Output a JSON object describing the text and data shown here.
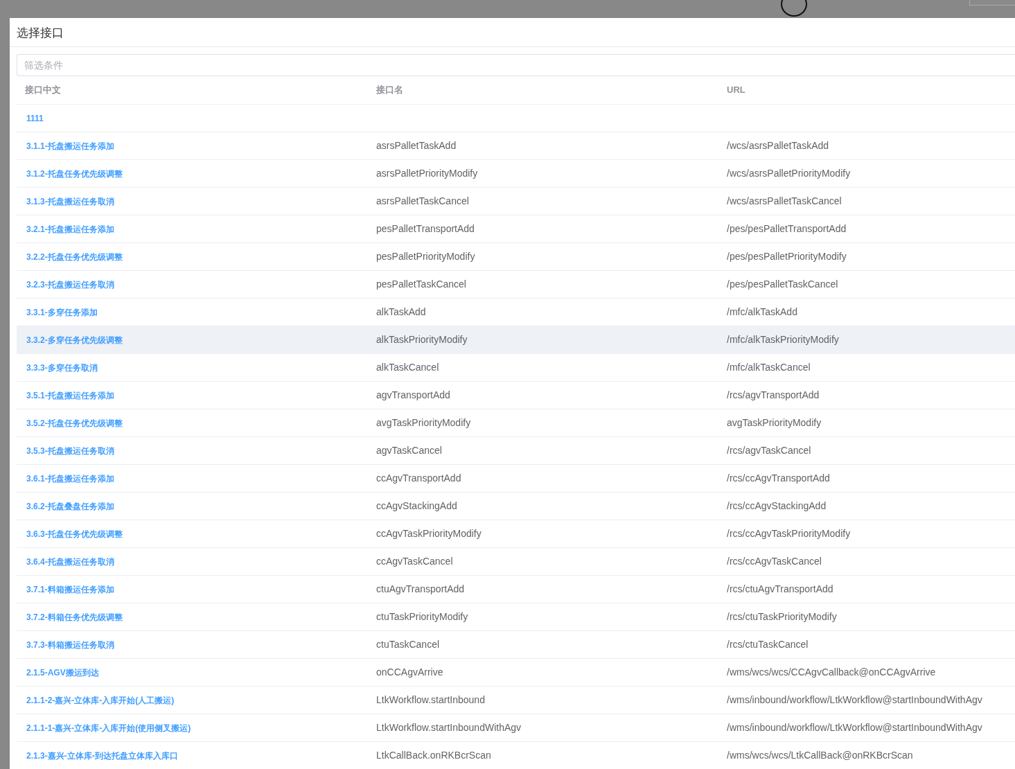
{
  "dialog": {
    "title": "选择接口",
    "filter": {
      "placeholder": "筛选条件"
    }
  },
  "table": {
    "columns": [
      "接口中文",
      "接口名",
      "URL"
    ],
    "rows": [
      {
        "cells": [
          "1111",
          "",
          ""
        ],
        "highlighted": false
      },
      {
        "cells": [
          "3.1.1-托盘搬运任务添加",
          "asrsPalletTaskAdd",
          "/wcs/asrsPalletTaskAdd"
        ],
        "highlighted": false
      },
      {
        "cells": [
          "3.1.2-托盘任务优先级调整",
          "asrsPalletPriorityModify",
          "/wcs/asrsPalletPriorityModify"
        ],
        "highlighted": false
      },
      {
        "cells": [
          "3.1.3-托盘搬运任务取消",
          "asrsPalletTaskCancel",
          "/wcs/asrsPalletTaskCancel"
        ],
        "highlighted": false
      },
      {
        "cells": [
          "3.2.1-托盘搬运任务添加",
          "pesPalletTransportAdd",
          "/pes/pesPalletTransportAdd"
        ],
        "highlighted": false
      },
      {
        "cells": [
          "3.2.2-托盘任务优先级调整",
          "pesPalletPriorityModify",
          "/pes/pesPalletPriorityModify"
        ],
        "highlighted": false
      },
      {
        "cells": [
          "3.2.3-托盘搬运任务取消",
          "pesPalletTaskCancel",
          "/pes/pesPalletTaskCancel"
        ],
        "highlighted": false
      },
      {
        "cells": [
          "3.3.1-多穿任务添加",
          "alkTaskAdd",
          "/mfc/alkTaskAdd"
        ],
        "highlighted": false
      },
      {
        "cells": [
          "3.3.2-多穿任务优先级调整",
          "alkTaskPriorityModify",
          "/mfc/alkTaskPriorityModify"
        ],
        "highlighted": true
      },
      {
        "cells": [
          "3.3.3-多穿任务取消",
          "alkTaskCancel",
          "/mfc/alkTaskCancel"
        ],
        "highlighted": false
      },
      {
        "cells": [
          "3.5.1-托盘搬运任务添加",
          "agvTransportAdd",
          "/rcs/agvTransportAdd"
        ],
        "highlighted": false
      },
      {
        "cells": [
          "3.5.2-托盘任务优先级调整",
          "avgTaskPriorityModify",
          "avgTaskPriorityModify"
        ],
        "highlighted": false
      },
      {
        "cells": [
          "3.5.3-托盘搬运任务取消",
          "agvTaskCancel",
          "/rcs/agvTaskCancel"
        ],
        "highlighted": false
      },
      {
        "cells": [
          "3.6.1-托盘搬运任务添加",
          "ccAgvTransportAdd",
          "/rcs/ccAgvTransportAdd"
        ],
        "highlighted": false
      },
      {
        "cells": [
          "3.6.2-托盘叠盘任务添加",
          "ccAgvStackingAdd",
          "/rcs/ccAgvStackingAdd"
        ],
        "highlighted": false
      },
      {
        "cells": [
          "3.6.3-托盘任务优先级调整",
          "ccAgvTaskPriorityModify",
          "/rcs/ccAgvTaskPriorityModify"
        ],
        "highlighted": false
      },
      {
        "cells": [
          "3.6.4-托盘搬运任务取消",
          "ccAgvTaskCancel",
          "/rcs/ccAgvTaskCancel"
        ],
        "highlighted": false
      },
      {
        "cells": [
          "3.7.1-料箱搬运任务添加",
          "ctuAgvTransportAdd",
          "/rcs/ctuAgvTransportAdd"
        ],
        "highlighted": false
      },
      {
        "cells": [
          "3.7.2-料箱任务优先级调整",
          "ctuTaskPriorityModify",
          "/rcs/ctuTaskPriorityModify"
        ],
        "highlighted": false
      },
      {
        "cells": [
          "3.7.3-料箱搬运任务取消",
          "ctuTaskCancel",
          "/rcs/ctuTaskCancel"
        ],
        "highlighted": false
      },
      {
        "cells": [
          "2.1.5-AGV搬运到达",
          "onCCAgvArrive",
          "/wms/wcs/wcs/CCAgvCallback@onCCAgvArrive"
        ],
        "highlighted": false
      },
      {
        "cells": [
          "2.1.1-2-嘉兴-立体库-入库开始(人工搬运)",
          "LtkWorkflow.startInbound",
          "/wms/inbound/workflow/LtkWorkflow@startInboundWithAgv"
        ],
        "highlighted": false
      },
      {
        "cells": [
          "2.1.1-1-嘉兴-立体库-入库开始(使用侧叉搬运)",
          "LtkWorkflow.startInboundWithAgv",
          "/wms/inbound/workflow/LtkWorkflow@startInboundWithAgv"
        ],
        "highlighted": false
      },
      {
        "cells": [
          "2.1.3-嘉兴-立体库-到达托盘立体库入库口",
          "LtkCallBack.onRKBcrScan",
          "/wms/wcs/wcs/LtkCallBack@onRKBcrScan"
        ],
        "highlighted": false
      }
    ]
  }
}
